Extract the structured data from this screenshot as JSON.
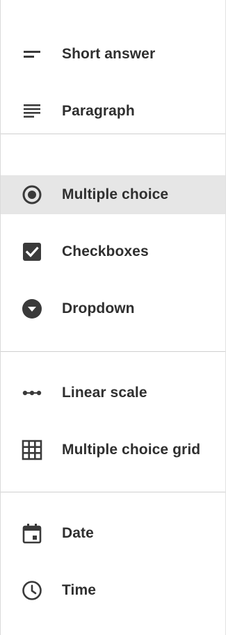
{
  "menu": {
    "items": [
      {
        "label": "Short answer",
        "icon": "short-answer-icon"
      },
      {
        "label": "Paragraph",
        "icon": "paragraph-icon"
      },
      {
        "label": "Multiple choice",
        "icon": "radio-button-icon",
        "selected": true
      },
      {
        "label": "Checkboxes",
        "icon": "checkbox-icon"
      },
      {
        "label": "Dropdown",
        "icon": "dropdown-icon"
      },
      {
        "label": "Linear scale",
        "icon": "linear-scale-icon"
      },
      {
        "label": "Multiple choice grid",
        "icon": "grid-icon"
      },
      {
        "label": "Date",
        "icon": "calendar-icon"
      },
      {
        "label": "Time",
        "icon": "clock-icon"
      }
    ]
  },
  "colors": {
    "icon": "#3a3a3a",
    "text": "#2f2f2f",
    "selected_background": "#e6e6e6",
    "divider": "#cfcfcf"
  }
}
